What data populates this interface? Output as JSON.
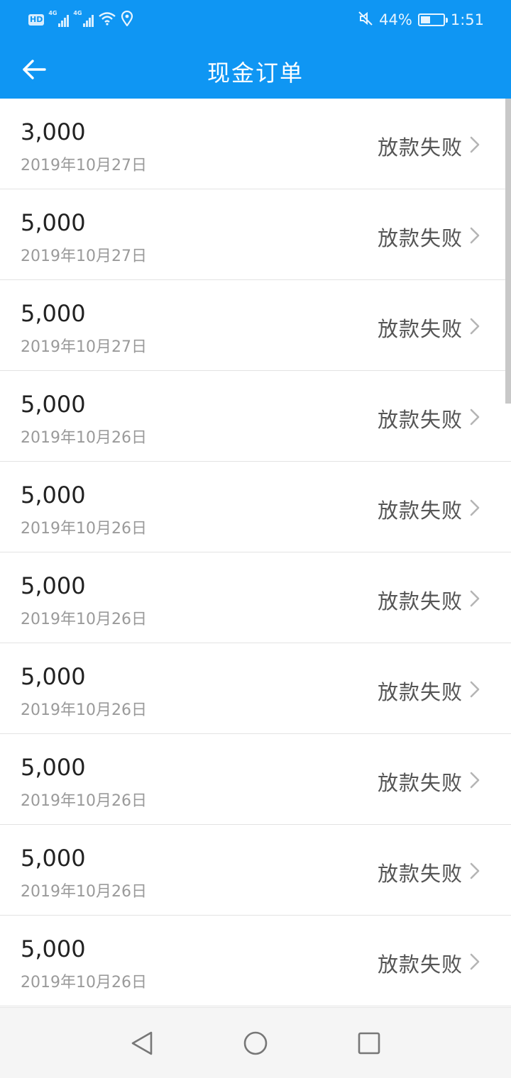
{
  "status_bar": {
    "hd_label": "HD",
    "network1": "4G",
    "network2": "4G",
    "battery_percent": "44%",
    "battery_level": 0.44,
    "time": "1:51",
    "icons": [
      "wifi-icon",
      "location-icon",
      "mute-icon",
      "battery-icon"
    ]
  },
  "header": {
    "title": "现金订单",
    "back_icon": "arrow-left-icon",
    "background": "#0f96f3"
  },
  "orders": [
    {
      "amount": "3,000",
      "date": "2019年10月27日",
      "status": "放款失败"
    },
    {
      "amount": "5,000",
      "date": "2019年10月27日",
      "status": "放款失败"
    },
    {
      "amount": "5,000",
      "date": "2019年10月27日",
      "status": "放款失败"
    },
    {
      "amount": "5,000",
      "date": "2019年10月26日",
      "status": "放款失败"
    },
    {
      "amount": "5,000",
      "date": "2019年10月26日",
      "status": "放款失败"
    },
    {
      "amount": "5,000",
      "date": "2019年10月26日",
      "status": "放款失败"
    },
    {
      "amount": "5,000",
      "date": "2019年10月26日",
      "status": "放款失败"
    },
    {
      "amount": "5,000",
      "date": "2019年10月26日",
      "status": "放款失败"
    },
    {
      "amount": "5,000",
      "date": "2019年10月26日",
      "status": "放款失败"
    },
    {
      "amount": "5,000",
      "date": "2019年10月26日",
      "status": "放款失败"
    }
  ],
  "nav_bar": {
    "icons": [
      "back-triangle-icon",
      "home-circle-icon",
      "recents-square-icon"
    ]
  }
}
